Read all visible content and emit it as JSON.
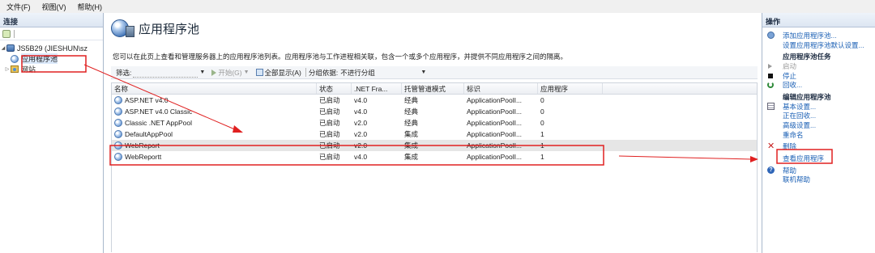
{
  "menu": {
    "file": "文件(F)",
    "view": "视图(V)",
    "help": "帮助(H)"
  },
  "left": {
    "header": "连接",
    "server_label": "JS5B29 (JIESHUN\\sz",
    "apppools_label": "应用程序池",
    "sites_label": "网站"
  },
  "center": {
    "title": "应用程序池",
    "description": "您可以在此页上查看和管理服务器上的应用程序池列表。应用程序池与工作进程相关联，包含一个或多个应用程序，并提供不同应用程序之间的隔离。",
    "filter": {
      "label": "筛选:",
      "start": "开始(G)",
      "show_all": "全部显示(A)",
      "group_by": "分组依据:",
      "group_value": "不进行分组"
    },
    "columns": [
      "名称",
      "状态",
      ".NET Fra...",
      "托管管道模式",
      "标识",
      "应用程序"
    ],
    "rows": [
      {
        "name": "ASP.NET v4.0",
        "state": "已启动",
        "net": "v4.0",
        "mode": "经典",
        "identity": "ApplicationPoolI...",
        "apps": "0"
      },
      {
        "name": "ASP.NET v4.0 Classic",
        "state": "已启动",
        "net": "v4.0",
        "mode": "经典",
        "identity": "ApplicationPoolI...",
        "apps": "0"
      },
      {
        "name": "Classic .NET AppPool",
        "state": "已启动",
        "net": "v2.0",
        "mode": "经典",
        "identity": "ApplicationPoolI...",
        "apps": "0"
      },
      {
        "name": "DefaultAppPool",
        "state": "已启动",
        "net": "v2.0",
        "mode": "集成",
        "identity": "ApplicationPoolI...",
        "apps": "1"
      },
      {
        "name": "WebReport",
        "state": "已启动",
        "net": "v2.0",
        "mode": "集成",
        "identity": "ApplicationPoolI...",
        "apps": "1"
      },
      {
        "name": "WebReportt",
        "state": "已启动",
        "net": "v4.0",
        "mode": "集成",
        "identity": "ApplicationPoolI...",
        "apps": "1"
      }
    ]
  },
  "right": {
    "header": "操作",
    "add_pool": "添加应用程序池...",
    "set_defaults": "设置应用程序池默认设置...",
    "tasks_header": "应用程序池任务",
    "start": "启动",
    "stop": "停止",
    "recycle": "回收...",
    "edit_header": "编辑应用程序池",
    "basic_settings": "基本设置...",
    "recycling": "正在回收...",
    "advanced_settings": "高级设置...",
    "rename": "重命名",
    "delete": "删除",
    "view_apps": "查看应用程序",
    "help": "帮助",
    "online_help": "联机帮助"
  },
  "colors": {
    "annotation": "#e02020",
    "link": "#1a5fb4",
    "selected_row": "#e6e6e6"
  }
}
